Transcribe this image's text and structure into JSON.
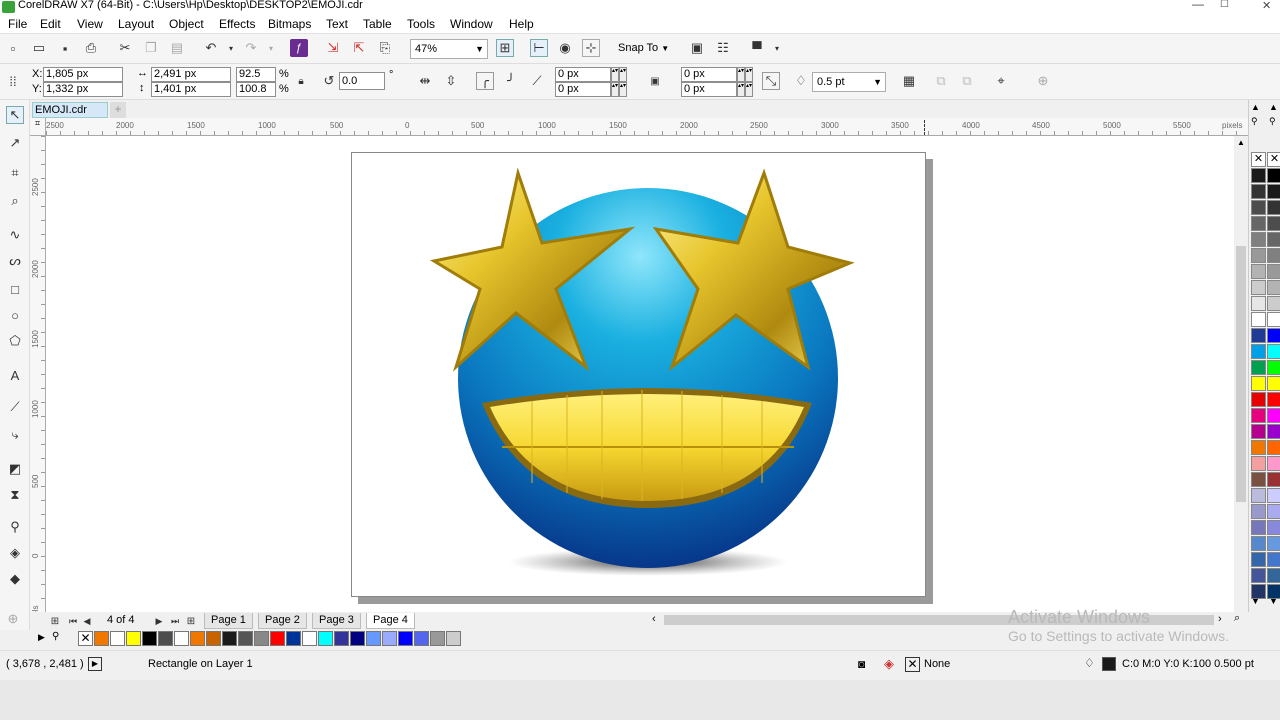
{
  "window": {
    "title": "CorelDRAW X7 (64-Bit) - C:\\Users\\Hp\\Desktop\\DESKTOP2\\EMOJI.cdr",
    "minimize": "—",
    "maximize": "☐",
    "close": "✕"
  },
  "menu": [
    "File",
    "Edit",
    "View",
    "Layout",
    "Object",
    "Effects",
    "Bitmaps",
    "Text",
    "Table",
    "Tools",
    "Window",
    "Help"
  ],
  "standard": {
    "zoom": "47%",
    "snap_to": "Snap To"
  },
  "properties": {
    "x": "1,805 px",
    "y": "1,332 px",
    "x_label": "X:",
    "y_label": "Y:",
    "width": "2,491 px",
    "height": "1,401 px",
    "scale_w": "92.5",
    "scale_h": "100.8",
    "percent": "%",
    "rotation": "0.0",
    "degree": "°",
    "corner_1": "0 px",
    "corner_2": "0 px",
    "corner_3": "0 px",
    "corner_4": "0 px",
    "outline": "0.5 pt"
  },
  "document": {
    "tab": "EMOJI.cdr"
  },
  "ruler": {
    "h_labels": [
      "2500",
      "2000",
      "1500",
      "1000",
      "500",
      "0",
      "500",
      "1000",
      "1500",
      "2000",
      "2500",
      "3000",
      "3500",
      "4000",
      "4500",
      "5000",
      "5500"
    ],
    "unit": "pixels",
    "v_labels": [
      "2500",
      "2000",
      "1500",
      "1000",
      "500",
      "0"
    ],
    "v_unit": "pixels"
  },
  "pages": {
    "counter": "4 of 4",
    "tabs": [
      "Page 1",
      "Page 2",
      "Page 3",
      "Page 4"
    ],
    "active": "Page 4"
  },
  "palette_bottom": [
    "#f07800",
    "#ffffff",
    "#ffff00",
    "#000000",
    "#4d4d4d",
    "#ffffff",
    "#f07800",
    "#c86400",
    "#1a1a1a",
    "#555555",
    "#888888",
    "#ff0000",
    "#003399",
    "#ffffff",
    "#00ffff",
    "#333399",
    "#000080",
    "#6699ff",
    "#99aaff",
    "#0000ff",
    "#5566ee",
    "#999999",
    "#cccccc"
  ],
  "palette_right": [
    "#1a1a1a",
    "#333333",
    "#4d4d4d",
    "#666666",
    "#808080",
    "#999999",
    "#b3b3b3",
    "#cccccc",
    "#e6e6e6",
    "#ffffff",
    "#1e3c96",
    "#00a0e6",
    "#00a050",
    "#ffff00",
    "#e60000",
    "#e6007e",
    "#b4008c",
    "#f07800",
    "#f5a0a0",
    "#7a5040",
    "#bbbbdd",
    "#9999cc",
    "#7777bb",
    "#5588cc",
    "#3366aa",
    "#445599",
    "#223366"
  ],
  "palette_right2": [
    "#000000",
    "#1a1a1a",
    "#333333",
    "#4d4d4d",
    "#666666",
    "#808080",
    "#999999",
    "#b3b3b3",
    "#cccccc",
    "#ffffff",
    "#0000ff",
    "#00ffff",
    "#00ff00",
    "#ffff00",
    "#ff0000",
    "#ff00ff",
    "#9900cc",
    "#ff6600",
    "#ff99cc",
    "#993333",
    "#ccccff",
    "#aaaaee",
    "#8888dd",
    "#6699dd",
    "#4477cc",
    "#336699",
    "#003366"
  ],
  "status": {
    "coords": "( 3,678 , 2,481 )",
    "object": "Rectangle on Layer 1",
    "fill": "None",
    "outline": "C:0 M:0 Y:0 K:100  0.500 pt"
  },
  "watermark": {
    "line1": "Activate Windows",
    "line2": "Go to Settings to activate Windows."
  }
}
